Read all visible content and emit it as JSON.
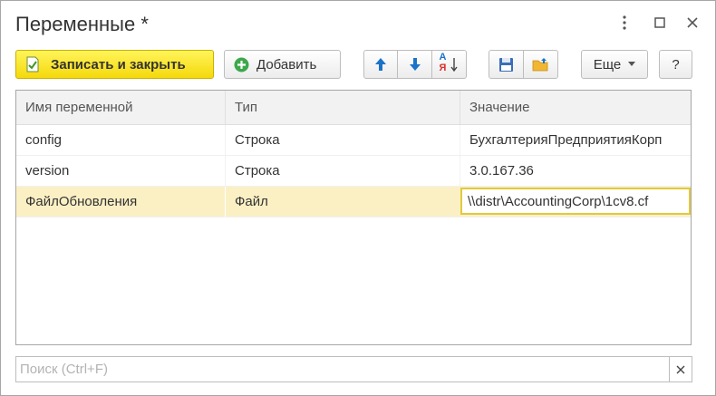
{
  "window": {
    "title": "Переменные *"
  },
  "toolbar": {
    "save_close_label": "Записать и закрыть",
    "add_label": "Добавить",
    "sort_label_top": "А",
    "sort_label_bottom": "Я",
    "more_label": "Еще",
    "help_label": "?"
  },
  "table": {
    "columns": [
      "Имя переменной",
      "Тип",
      "Значение"
    ],
    "rows": [
      {
        "name": "config",
        "type": "Строка",
        "value": "БухгалтерияПредприятияКорп"
      },
      {
        "name": "version",
        "type": "Строка",
        "value": "3.0.167.36"
      },
      {
        "name": "ФайлОбновления",
        "type": "Файл",
        "value": "\\\\distr\\AccountingCorp\\1cv8.cf"
      }
    ],
    "selected_row": 2
  },
  "search": {
    "placeholder": "Поиск (Ctrl+F)"
  },
  "colors": {
    "primary_button": "#f5d90c",
    "selected_row": "#fbf0c4",
    "edit_border": "#e3c93d",
    "arrow_blue": "#1a73c9"
  },
  "icons": [
    "kebab-menu-icon",
    "maximize-icon",
    "close-icon",
    "save-close-icon",
    "add-circle-icon",
    "move-up-icon",
    "move-down-icon",
    "sort-alpha-icon",
    "save-disk-icon",
    "open-folder-icon",
    "chevron-down-icon",
    "clear-icon"
  ]
}
